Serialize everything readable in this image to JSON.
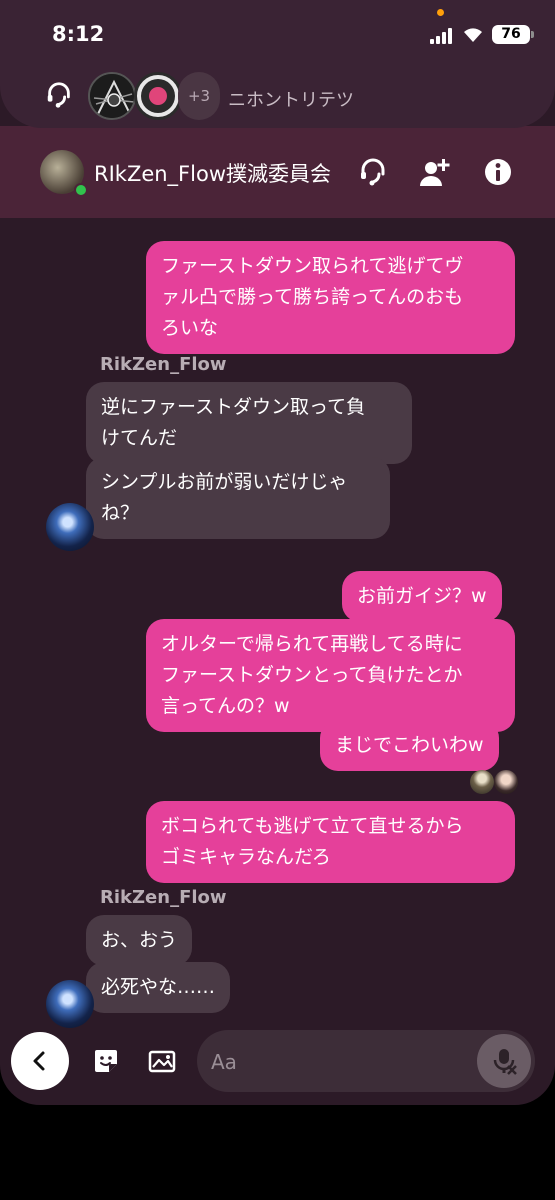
{
  "status_bar": {
    "time": "8:12",
    "battery": "76"
  },
  "call_bar": {
    "more_count": "+3",
    "group_name": "ニホントリテツ"
  },
  "header": {
    "title": "RIkZen_Flow撲滅委員会"
  },
  "messages": [
    {
      "text": "ファーストダウン取られて逃げてヴ\nァル凸で勝って勝ち誇ってんのおも\nろいな"
    },
    {
      "sender": "RikZen_Flow"
    },
    {
      "text": "逆にファーストダウン取って負\nけてんだ"
    },
    {
      "text": "シンプルお前が弱いだけじゃ\nね？"
    },
    {
      "text": "お前ガイジ？w"
    },
    {
      "text": "オルターで帰られて再戦してる時に\nファーストダウンとって負けたとか\n言ってんの？w"
    },
    {
      "text": "まじでこわいわw"
    },
    {
      "text": "ボコられても逃げて立て直せるから\nゴミキャラなんだろ"
    },
    {
      "sender": "RikZen_Flow"
    },
    {
      "text": "お、おう"
    },
    {
      "text": "必死やな……"
    }
  ],
  "composer": {
    "placeholder": "Aa"
  },
  "colors": {
    "outgoing_bubble": "#e5409a",
    "incoming_bubble": "#4a3a45",
    "background": "#2c1a27",
    "header": "#4b2438"
  }
}
